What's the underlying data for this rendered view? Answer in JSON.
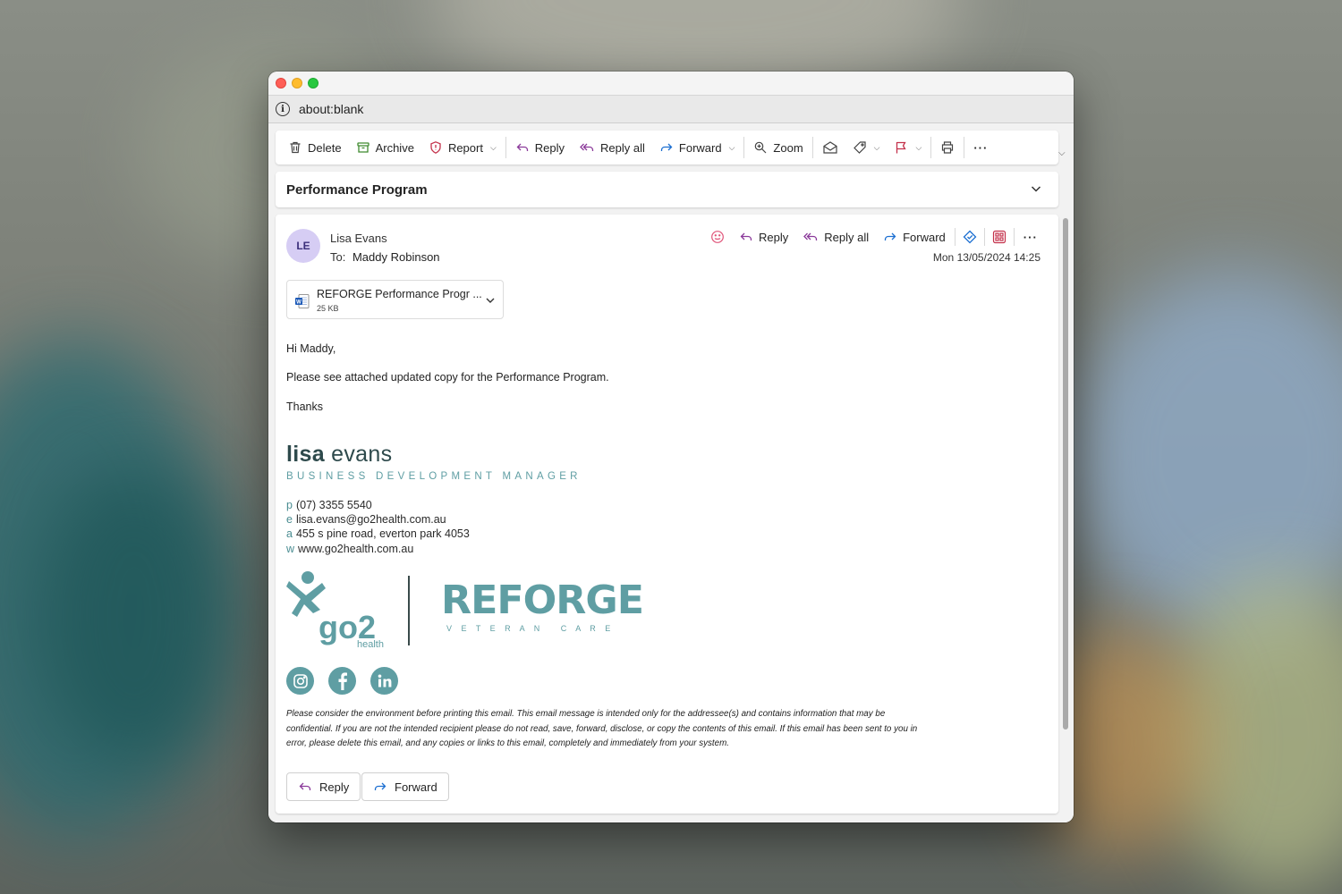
{
  "browser": {
    "url_prefix": "about:",
    "url_rest": "blank"
  },
  "toolbar": {
    "delete": "Delete",
    "archive": "Archive",
    "report": "Report",
    "reply": "Reply",
    "reply_all": "Reply all",
    "forward": "Forward",
    "zoom": "Zoom"
  },
  "subject": "Performance Program",
  "message": {
    "avatar_initials": "LE",
    "from": "Lisa Evans",
    "to_label": "To:",
    "to_name": "Maddy Robinson",
    "date": "Mon 13/05/2024 14:25",
    "actions": {
      "reply": "Reply",
      "reply_all": "Reply all",
      "forward": "Forward"
    },
    "attachment": {
      "name": "REFORGE Performance Progr ...",
      "size": "25 KB"
    },
    "body": [
      "Hi Maddy,",
      "Please see attached updated copy for the Performance Program.",
      "Thanks"
    ],
    "signature": {
      "first": "lisa",
      "last": "evans",
      "title": "BUSINESS DEVELOPMENT MANAGER",
      "phone_label": "p",
      "phone": "(07) 3355 5540",
      "email_label": "e",
      "email": "lisa.evans@go2health.com.au",
      "address_label": "a",
      "address": "455 s pine road, everton park 4053",
      "web_label": "w",
      "web": "www.go2health.com.au",
      "logo_go2_text": "go2",
      "logo_health_text": "health",
      "logo_reforge_text": "REFORGE",
      "logo_reforge_sub": "V E T E R A N   C A R E"
    },
    "disclaimer": "Please consider the environment before printing this email. This email message is intended only for the addressee(s) and contains information that may be confidential. If you are not the intended recipient please do not read, save, forward, disclose, or copy the contents of this email. If this email has been sent to you in error, please delete this email, and any copies or links to this email, completely and immediately from your system.",
    "footer": {
      "reply": "Reply",
      "forward": "Forward"
    }
  },
  "colors": {
    "accent_purple": "#8b3a9a",
    "accent_blue": "#1c6fd1",
    "brand_teal": "#5f9ea3",
    "report_red": "#c4314b"
  }
}
